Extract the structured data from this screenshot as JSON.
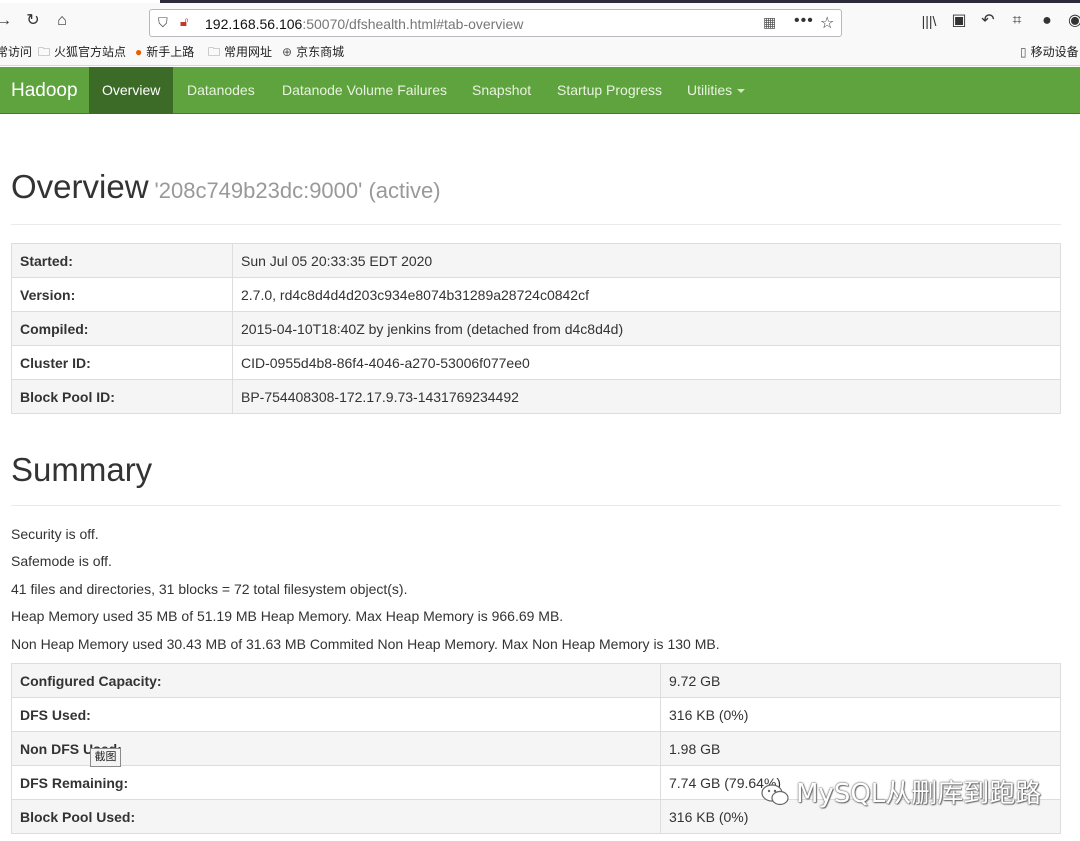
{
  "browser": {
    "url_host": "192.168.56.106",
    "url_rest": ":50070/dfshealth.html#tab-overview",
    "bookmarks": [
      "常访问",
      "火狐官方站点",
      "新手上路",
      "常用网址",
      "京东商城"
    ],
    "mobile_bookmarks": "移动设备"
  },
  "navbar": {
    "brand": "Hadoop",
    "items": [
      "Overview",
      "Datanodes",
      "Datanode Volume Failures",
      "Snapshot",
      "Startup Progress",
      "Utilities"
    ],
    "active_color": "#3c6b28",
    "bar_color": "#5fa33e"
  },
  "overview": {
    "title": "Overview",
    "subtitle": "'208c749b23dc:9000' (active)",
    "rows": [
      {
        "key": "Started:",
        "value": "Sun Jul 05 20:33:35 EDT 2020"
      },
      {
        "key": "Version:",
        "value": "2.7.0, rd4c8d4d4d203c934e8074b31289a28724c0842cf"
      },
      {
        "key": "Compiled:",
        "value": "2015-04-10T18:40Z by jenkins from (detached from d4c8d4d)"
      },
      {
        "key": "Cluster ID:",
        "value": "CID-0955d4b8-86f4-4046-a270-53006f077ee0"
      },
      {
        "key": "Block Pool ID:",
        "value": "BP-754408308-172.17.9.73-1431769234492"
      }
    ]
  },
  "summary": {
    "title": "Summary",
    "lines": [
      "Security is off.",
      "Safemode is off.",
      "41 files and directories, 31 blocks = 72 total filesystem object(s).",
      "Heap Memory used 35 MB of 51.19 MB Heap Memory. Max Heap Memory is 966.69 MB.",
      "Non Heap Memory used 30.43 MB of 31.63 MB Commited Non Heap Memory. Max Non Heap Memory is 130 MB."
    ],
    "rows": [
      {
        "key": "Configured Capacity:",
        "value": "9.72 GB"
      },
      {
        "key": "DFS Used:",
        "value": "316 KB (0%)"
      },
      {
        "key": "Non DFS Used:",
        "value": "1.98 GB"
      },
      {
        "key": "DFS Remaining:",
        "value": "7.74 GB (79.64%)"
      },
      {
        "key": "Block Pool Used:",
        "value": "316 KB (0%)"
      }
    ]
  },
  "overlay": {
    "tooltip": "截图",
    "watermark": "MySQL从删库到跑路"
  }
}
